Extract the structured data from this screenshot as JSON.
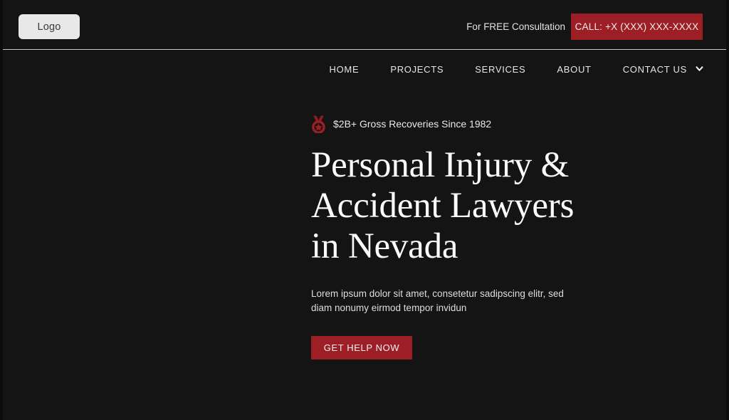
{
  "theme": {
    "background": "#141414",
    "accent_red": "#9d1f25",
    "text_light": "#e9e9e9",
    "logo_bg": "#e8e8e8"
  },
  "header": {
    "logo_label": "Logo",
    "consultation_text": "For FREE Consultation",
    "call_button_label": "CALL: +X (XXX) XXX-XXXX"
  },
  "nav": {
    "items": [
      {
        "label": "HOME"
      },
      {
        "label": "PROJECTS"
      },
      {
        "label": "SERVICES"
      },
      {
        "label": "ABOUT"
      },
      {
        "label": "CONTACT US",
        "icon": "chevron-down-icon"
      }
    ]
  },
  "hero": {
    "badge": {
      "icon": "medal-icon",
      "text": "$2B+ Gross Recoveries Since 1982"
    },
    "headline": "Personal Injury & Accident Lawyers in Nevada",
    "subtext": "Lorem ipsum dolor sit amet, consetetur sadipscing elitr, sed diam nonumy eirmod tempor invidun",
    "cta_label": "GET HELP NOW"
  }
}
